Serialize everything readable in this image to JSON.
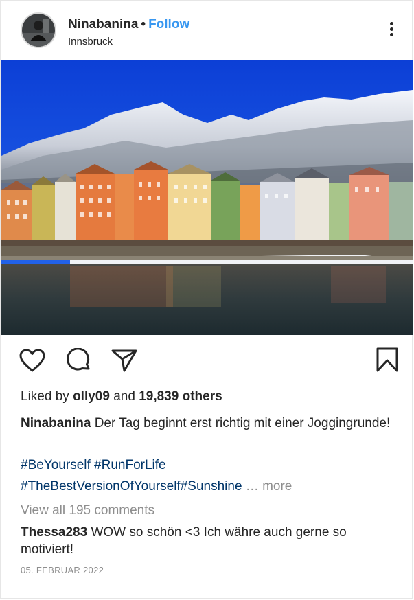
{
  "post": {
    "username": "Ninabanina",
    "separator": "•",
    "follow_label": "Follow",
    "location": "Innsbruck",
    "likes": {
      "prefix": "Liked by",
      "liker": "olly09",
      "conj": "and",
      "others": "19,839 others"
    },
    "caption": {
      "username": "Ninabanina",
      "text": "Der Tag beginnt erst richtig mit einer Joggingrunde!"
    },
    "hashtags_line1": [
      "#BeYourself",
      "#RunForLife"
    ],
    "hashtags_line2": [
      "#TheBestVersionOfYourself",
      "#Sunshine"
    ],
    "more_label": "… more",
    "view_all_comments": "View all 195 comments",
    "comment": {
      "username": "Thessa283",
      "text": "WOW so schön <3 Ich währe auch gerne so motiviert!"
    },
    "date": "05. FEBRUAR 2022"
  },
  "icons": {
    "like": "heart-icon",
    "comment": "comment-bubble-icon",
    "share": "paper-plane-icon",
    "save": "bookmark-icon",
    "more": "more-options-icon"
  },
  "colors": {
    "link": "#3897f0",
    "hashtag": "#003569",
    "muted": "#8e8e8e",
    "text": "#262626"
  }
}
